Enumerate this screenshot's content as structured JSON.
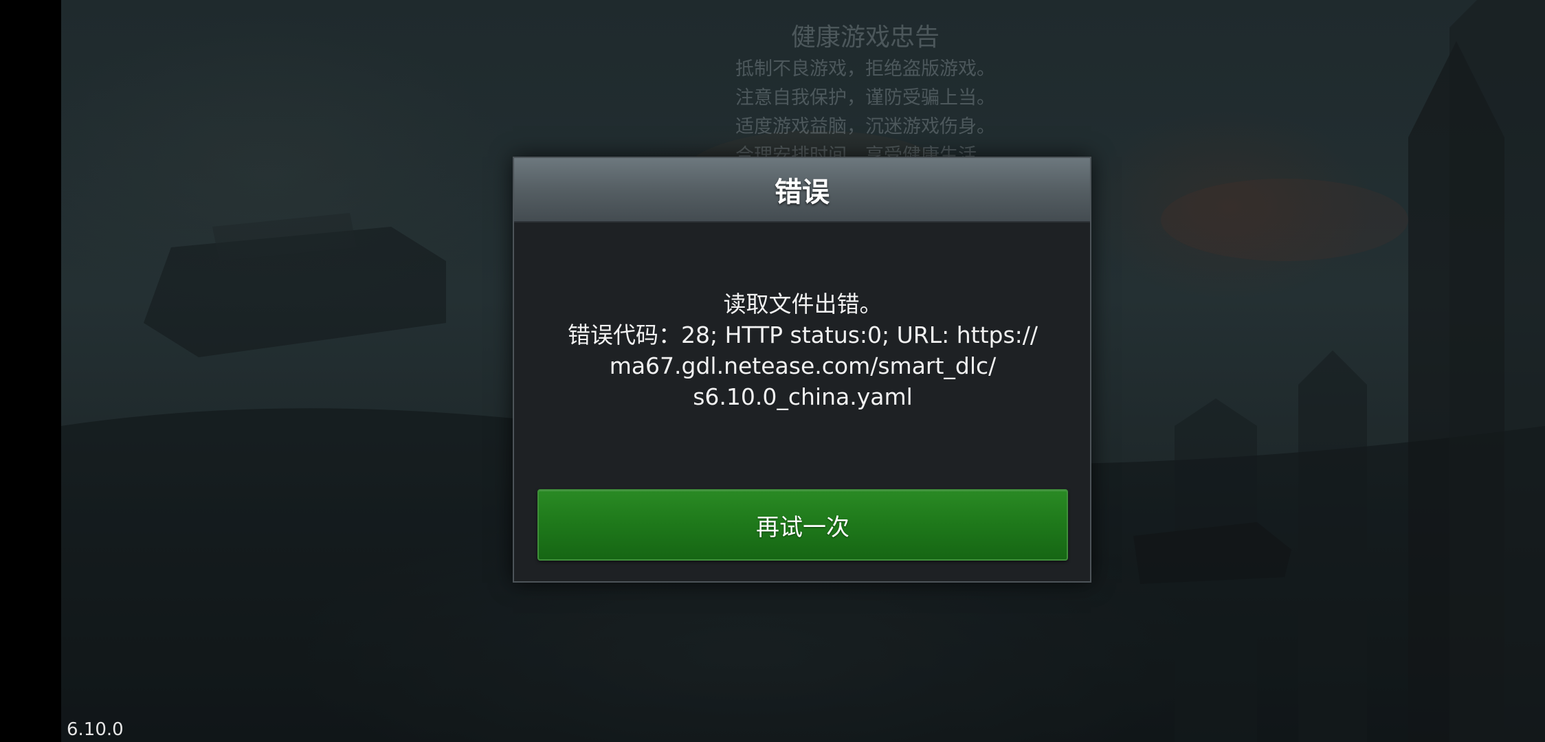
{
  "background": {
    "advisory": {
      "title": "健康游戏忠告",
      "lines": [
        "抵制不良游戏，拒绝盗版游戏。",
        "注意自我保护，谨防受骗上当。",
        "适度游戏益脑，沉迷游戏伤身。",
        "合理安排时间，享受健康生活。"
      ]
    }
  },
  "dialog": {
    "title": "错误",
    "message_lines": [
      "读取文件出错。",
      "错误代码：28; HTTP status:0; URL: https://",
      "ma67.gdl.netease.com/smart_dlc/",
      "s6.10.0_china.yaml"
    ],
    "retry_label": "再试一次"
  },
  "version": "6.10.0",
  "colors": {
    "button_green": "#1f7a1b",
    "dialog_bg": "#1e2124",
    "header_gray": "#555e63"
  }
}
